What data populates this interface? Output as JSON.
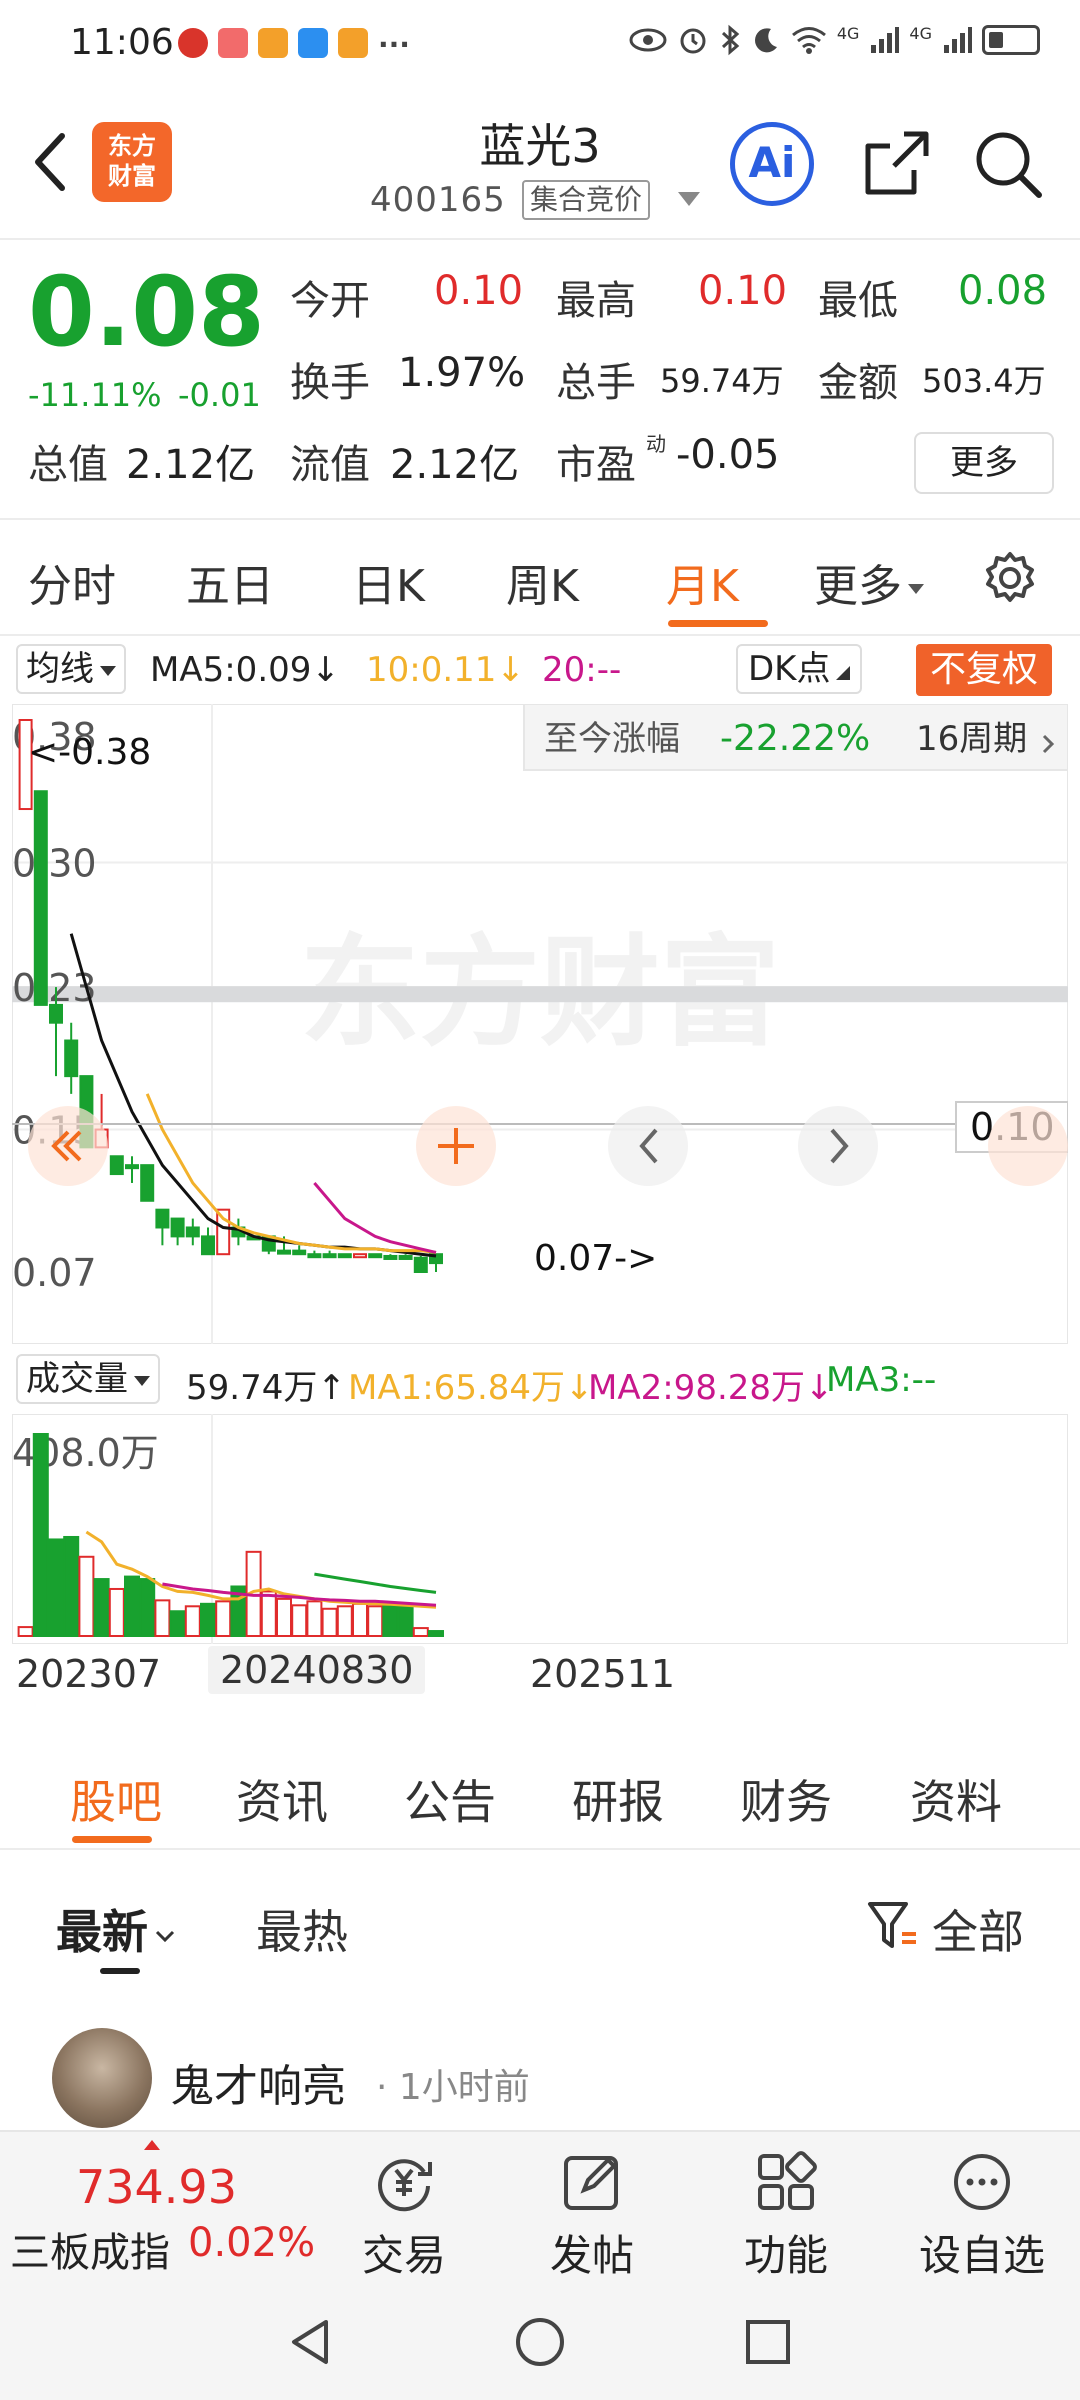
{
  "status_bar": {
    "time": "11:06",
    "dots": "···",
    "net_1": "4G",
    "net_2": "4G"
  },
  "header": {
    "logo_line1": "东方",
    "logo_line2": "财富",
    "stock_name": "蓝光3",
    "stock_code": "400165",
    "auction_badge": "集合竞价",
    "ai_label": "Ai"
  },
  "quote": {
    "price": "0.08",
    "change_pct": "-11.11%",
    "change_abs": "-0.01",
    "open_label": "今开",
    "open": "0.10",
    "high_label": "最高",
    "high": "0.10",
    "low_label": "最低",
    "low": "0.08",
    "turnover_label": "换手",
    "turnover": "1.97%",
    "volume_label": "总手",
    "volume": "59.74万",
    "amount_label": "金额",
    "amount": "503.4万",
    "mktcap_label": "总值",
    "mktcap": "2.12亿",
    "float_label": "流值",
    "float": "2.12亿",
    "pe_label": "市盈",
    "pe_sup": "动",
    "pe": "-0.05",
    "more_label": "更多"
  },
  "period_tabs": [
    "分时",
    "五日",
    "日K",
    "周K",
    "月K",
    "更多"
  ],
  "active_period": "月K",
  "indicators": {
    "junxian": "均线",
    "ma5": "MA5:0.09↓",
    "ma10": "10:0.11↓",
    "ma20": "20:--",
    "dk": "DK点",
    "fuquan": "不复权"
  },
  "kchart": {
    "range_label": "至今涨幅",
    "range_value": "-22.22%",
    "range_period": "16周期",
    "max_marker": "<-0.38",
    "min_marker": "0.07->",
    "last_price_box": "0.10",
    "watermark": "东方财富",
    "y_ticks": [
      "0.38",
      "0.30",
      "0.23",
      "0.15",
      "0.07"
    ]
  },
  "chart_data": {
    "type": "candlestick",
    "ylim": [
      0.07,
      0.38
    ],
    "y_ticks": [
      0.38,
      0.3,
      0.23,
      0.15,
      0.07
    ],
    "x_tick_labels": [
      "202307",
      "20240830",
      "202511"
    ],
    "candles": [
      {
        "o": 0.33,
        "c": 0.38,
        "h": 0.38,
        "l": 0.33
      },
      {
        "o": 0.34,
        "c": 0.22,
        "h": 0.34,
        "l": 0.22
      },
      {
        "o": 0.22,
        "c": 0.21,
        "h": 0.23,
        "l": 0.18
      },
      {
        "o": 0.2,
        "c": 0.18,
        "h": 0.21,
        "l": 0.17
      },
      {
        "o": 0.18,
        "c": 0.14,
        "h": 0.18,
        "l": 0.14
      },
      {
        "o": 0.14,
        "c": 0.15,
        "h": 0.17,
        "l": 0.14
      },
      {
        "o": 0.135,
        "c": 0.125,
        "h": 0.135,
        "l": 0.125
      },
      {
        "o": 0.13,
        "c": 0.13,
        "h": 0.135,
        "l": 0.12
      },
      {
        "o": 0.13,
        "c": 0.11,
        "h": 0.13,
        "l": 0.11
      },
      {
        "o": 0.105,
        "c": 0.095,
        "h": 0.105,
        "l": 0.085
      },
      {
        "o": 0.1,
        "c": 0.09,
        "h": 0.1,
        "l": 0.085
      },
      {
        "o": 0.095,
        "c": 0.09,
        "h": 0.1,
        "l": 0.085
      },
      {
        "o": 0.09,
        "c": 0.08,
        "h": 0.095,
        "l": 0.08
      },
      {
        "o": 0.08,
        "c": 0.105,
        "h": 0.105,
        "l": 0.08
      },
      {
        "o": 0.095,
        "c": 0.09,
        "h": 0.1,
        "l": 0.085
      },
      {
        "o": 0.09,
        "c": 0.09,
        "h": 0.09,
        "l": 0.09
      },
      {
        "o": 0.09,
        "c": 0.082,
        "h": 0.09,
        "l": 0.08
      },
      {
        "o": 0.082,
        "c": 0.082,
        "h": 0.09,
        "l": 0.08
      },
      {
        "o": 0.082,
        "c": 0.08,
        "h": 0.085,
        "l": 0.08
      },
      {
        "o": 0.08,
        "c": 0.08,
        "h": 0.082,
        "l": 0.078
      },
      {
        "o": 0.08,
        "c": 0.08,
        "h": 0.082,
        "l": 0.078
      },
      {
        "o": 0.08,
        "c": 0.079,
        "h": 0.08,
        "l": 0.078
      },
      {
        "o": 0.079,
        "c": 0.08,
        "h": 0.08,
        "l": 0.078
      },
      {
        "o": 0.08,
        "c": 0.079,
        "h": 0.08,
        "l": 0.078
      },
      {
        "o": 0.079,
        "c": 0.079,
        "h": 0.08,
        "l": 0.078
      },
      {
        "o": 0.079,
        "c": 0.079,
        "h": 0.08,
        "l": 0.078
      },
      {
        "o": 0.078,
        "c": 0.07,
        "h": 0.079,
        "l": 0.07
      },
      {
        "o": 0.08,
        "c": 0.075,
        "h": 0.08,
        "l": 0.07
      }
    ],
    "ma_lines": [
      {
        "name": "MA5",
        "color": "#111111",
        "values": [
          null,
          null,
          null,
          0.26,
          0.23,
          0.2,
          0.18,
          0.16,
          0.145,
          0.13,
          0.12,
          0.11,
          0.1,
          0.095,
          0.094,
          0.09,
          0.088,
          0.087,
          0.086,
          0.085,
          0.084,
          0.084,
          0.083,
          0.083,
          0.082,
          0.081,
          0.08,
          0.079
        ]
      },
      {
        "name": "MA10",
        "color": "#f2b12b",
        "values": [
          null,
          null,
          null,
          null,
          null,
          null,
          null,
          null,
          0.17,
          0.15,
          0.135,
          0.12,
          0.11,
          0.1,
          0.095,
          0.092,
          0.09,
          0.088,
          0.086,
          0.085,
          0.084,
          0.083,
          0.083,
          0.083,
          0.082,
          0.082,
          0.082,
          0.081
        ]
      },
      {
        "name": "MA20",
        "color": "#c8178b",
        "values": [
          null,
          null,
          null,
          null,
          null,
          null,
          null,
          null,
          null,
          null,
          null,
          null,
          null,
          null,
          null,
          null,
          null,
          null,
          null,
          0.12,
          0.11,
          0.1,
          0.095,
          0.09,
          0.087,
          0.085,
          0.083,
          0.081
        ]
      }
    ],
    "volume_series": [
      {
        "v": 18,
        "up": true
      },
      {
        "v": 408,
        "up": false
      },
      {
        "v": 195,
        "up": false
      },
      {
        "v": 200,
        "up": false
      },
      {
        "v": 160,
        "up": true
      },
      {
        "v": 115,
        "up": false
      },
      {
        "v": 95,
        "up": true
      },
      {
        "v": 120,
        "up": false
      },
      {
        "v": 115,
        "up": false
      },
      {
        "v": 72,
        "up": true
      },
      {
        "v": 50,
        "up": false
      },
      {
        "v": 60,
        "up": true
      },
      {
        "v": 65,
        "up": false
      },
      {
        "v": 70,
        "up": true
      },
      {
        "v": 100,
        "up": false
      },
      {
        "v": 170,
        "up": true
      },
      {
        "v": 90,
        "up": true
      },
      {
        "v": 75,
        "up": true
      },
      {
        "v": 62,
        "up": true
      },
      {
        "v": 70,
        "up": true
      },
      {
        "v": 55,
        "up": true
      },
      {
        "v": 60,
        "up": true
      },
      {
        "v": 65,
        "up": true
      },
      {
        "v": 60,
        "up": true
      },
      {
        "v": 62,
        "up": false
      },
      {
        "v": 60,
        "up": false
      },
      {
        "v": 16,
        "up": true
      },
      {
        "v": 10,
        "up": false
      }
    ],
    "volume_ma": [
      {
        "name": "MA1",
        "color": "#f2b12b",
        "values": [
          null,
          null,
          null,
          null,
          210,
          190,
          145,
          135,
          120,
          100,
          90,
          88,
          82,
          75,
          75,
          90,
          95,
          85,
          80,
          75,
          70,
          68,
          66,
          65,
          64,
          62,
          60,
          58
        ]
      },
      {
        "name": "MA2",
        "color": "#c8178b",
        "values": [
          null,
          null,
          null,
          null,
          null,
          null,
          null,
          null,
          null,
          105,
          100,
          95,
          92,
          88,
          85,
          82,
          82,
          80,
          78,
          75,
          73,
          72,
          70,
          70,
          68,
          66,
          64,
          62
        ]
      },
      {
        "name": "MA3",
        "color": "#18a12f",
        "values": [
          null,
          null,
          null,
          null,
          null,
          null,
          null,
          null,
          null,
          null,
          null,
          null,
          null,
          null,
          null,
          null,
          null,
          null,
          null,
          125,
          120,
          115,
          110,
          105,
          100,
          96,
          92,
          88
        ]
      }
    ],
    "volume_ylim": [
      0,
      408
    ]
  },
  "volume": {
    "label": "成交量",
    "value": "59.74万↑",
    "ma1": "MA1:65.84万↓",
    "ma2": "MA2:98.28万↓",
    "ma3": "MA3:--",
    "max_label": "408.0万"
  },
  "xlabels": [
    "202307",
    "20240830",
    "202511"
  ],
  "community_tabs": [
    "股吧",
    "资讯",
    "公告",
    "研报",
    "财务",
    "资料"
  ],
  "active_community_tab": "股吧",
  "sort": {
    "newest": "最新",
    "hottest": "最热",
    "filter": "全部"
  },
  "post": {
    "username": "鬼才响亮",
    "time": "· 1小时前"
  },
  "bottom_bar": {
    "index_value": "734.93",
    "index_name": "三板成指",
    "index_change": "0.02%",
    "trade": "交易",
    "post": "发帖",
    "function": "功能",
    "watchlist": "设自选"
  },
  "colors": {
    "up": "#e02b2b",
    "down": "#18a12f",
    "accent": "#f26b1d",
    "ai": "#2b5fe0"
  }
}
